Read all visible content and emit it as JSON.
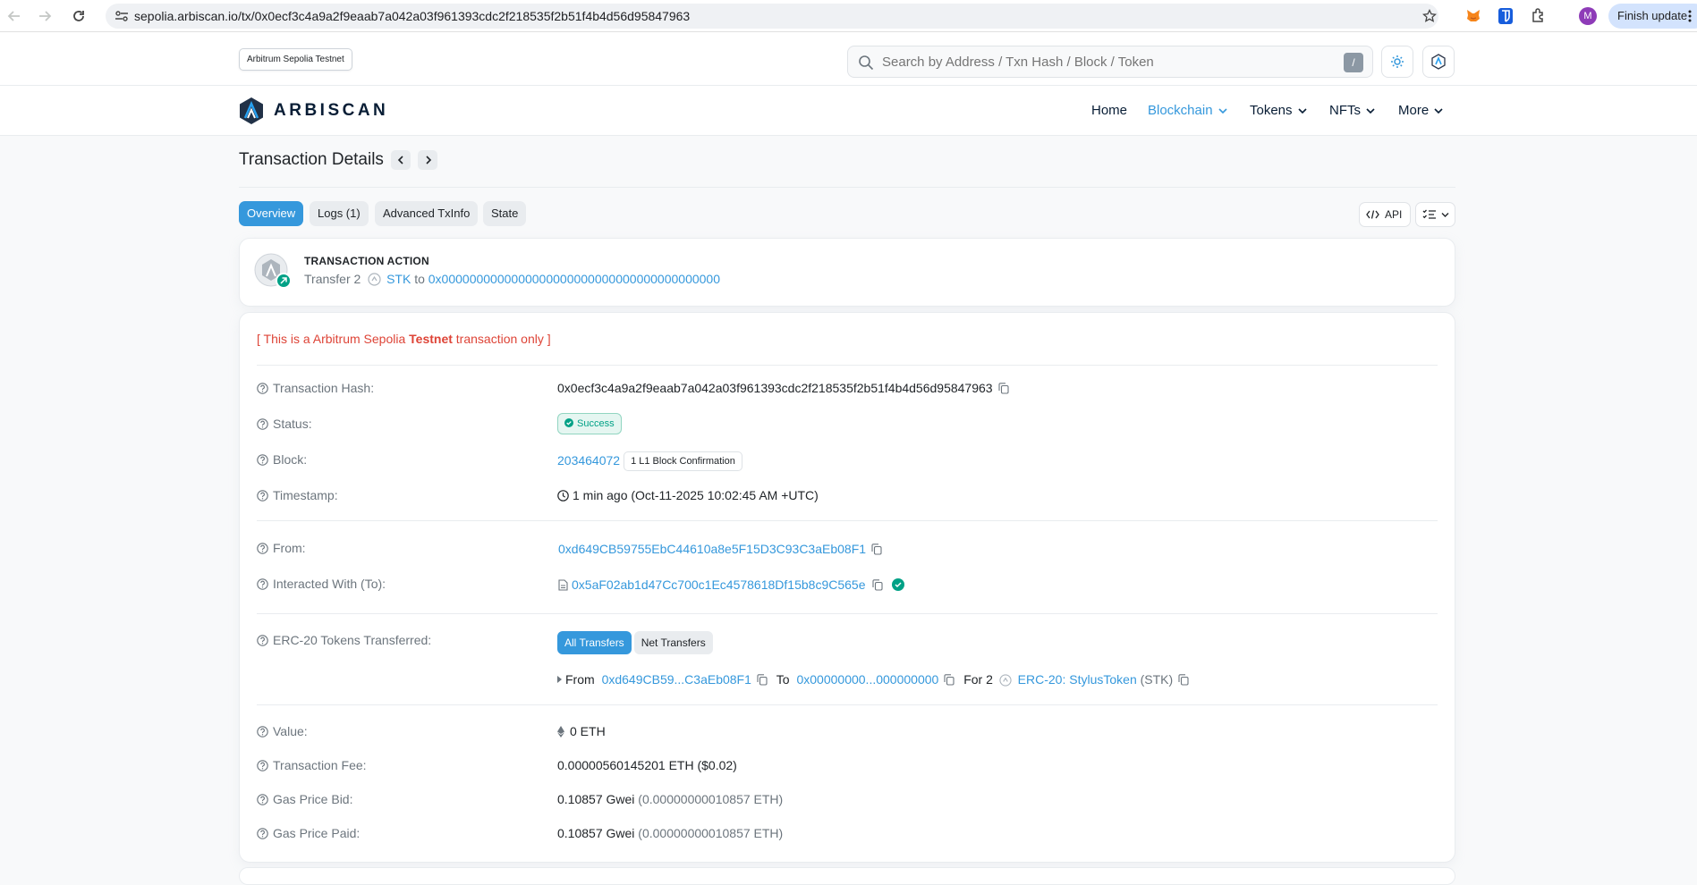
{
  "browser": {
    "url": "sepolia.arbiscan.io/tx/0x0ecf3c4a9a2f9eaab7a042a03f961393cdc2f218535f2b51f4b4d56d95847963",
    "profile_initial": "M",
    "finish_update_label": "Finish update"
  },
  "header": {
    "network_badge": "Arbitrum Sepolia Testnet",
    "search_placeholder": "Search by Address / Txn Hash / Block / Token",
    "search_shortcut": "/"
  },
  "nav": {
    "logo": "ARBISCAN",
    "items": [
      {
        "label": "Home",
        "active": false,
        "dropdown": false
      },
      {
        "label": "Blockchain",
        "active": true,
        "dropdown": true
      },
      {
        "label": "Tokens",
        "active": false,
        "dropdown": true
      },
      {
        "label": "NFTs",
        "active": false,
        "dropdown": true
      },
      {
        "label": "More",
        "active": false,
        "dropdown": true
      }
    ]
  },
  "page": {
    "title": "Transaction Details",
    "tabs": [
      {
        "label": "Overview",
        "active": true
      },
      {
        "label": "Logs (1)",
        "active": false
      },
      {
        "label": "Advanced TxInfo",
        "active": false
      },
      {
        "label": "State",
        "active": false
      }
    ],
    "api_label": "API"
  },
  "tx_action": {
    "title": "TRANSACTION ACTION",
    "prefix": "Transfer 2",
    "token": "STK",
    "to_word": "to",
    "to_address": "0x0000000000000000000000000000000000000000"
  },
  "details": {
    "note_prefix": "[ This is a Arbitrum Sepolia ",
    "note_bold": "Testnet",
    "note_suffix": " transaction only ]",
    "hash_label": "Transaction Hash:",
    "hash": "0x0ecf3c4a9a2f9eaab7a042a03f961393cdc2f218535f2b51f4b4d56d95847963",
    "status_label": "Status:",
    "status": "Success",
    "block_label": "Block:",
    "block": "203464072",
    "confirmations": "1 L1 Block Confirmation",
    "timestamp_label": "Timestamp:",
    "timestamp": "1 min ago (Oct-11-2025 10:02:45 AM +UTC)",
    "from_label": "From:",
    "from": "0xd649CB59755EbC44610a8e5F15D3C93C3aEb08F1",
    "to_label": "Interacted With (To):",
    "to": "0x5aF02ab1d47Cc700c1Ec4578618Df15b8c9C565e",
    "erc20_label": "ERC-20 Tokens Transferred:",
    "all_transfers": "All Transfers",
    "net_transfers": "Net Transfers",
    "transfer": {
      "from_word": "From",
      "from": "0xd649CB59...C3aEb08F1",
      "to_word": "To",
      "to": "0x00000000...000000000",
      "for_word": "For",
      "amount": "2",
      "token_name": "ERC-20: StylusToken",
      "token_symbol": "(STK)"
    },
    "value_label": "Value:",
    "value": "0 ETH",
    "fee_label": "Transaction Fee:",
    "fee": "0.00000560145201 ETH ($0.02)",
    "gas_bid_label": "Gas Price Bid:",
    "gas_bid": "0.10857 Gwei",
    "gas_bid_eth": "(0.00000000010857 ETH)",
    "gas_paid_label": "Gas Price Paid:",
    "gas_paid": "0.10857 Gwei",
    "gas_paid_eth": "(0.00000000010857 ETH)"
  },
  "colors": {
    "accent": "#3598dc",
    "success": "#00a186",
    "danger": "#de4437",
    "text": "#212529",
    "muted": "#6c757d"
  }
}
